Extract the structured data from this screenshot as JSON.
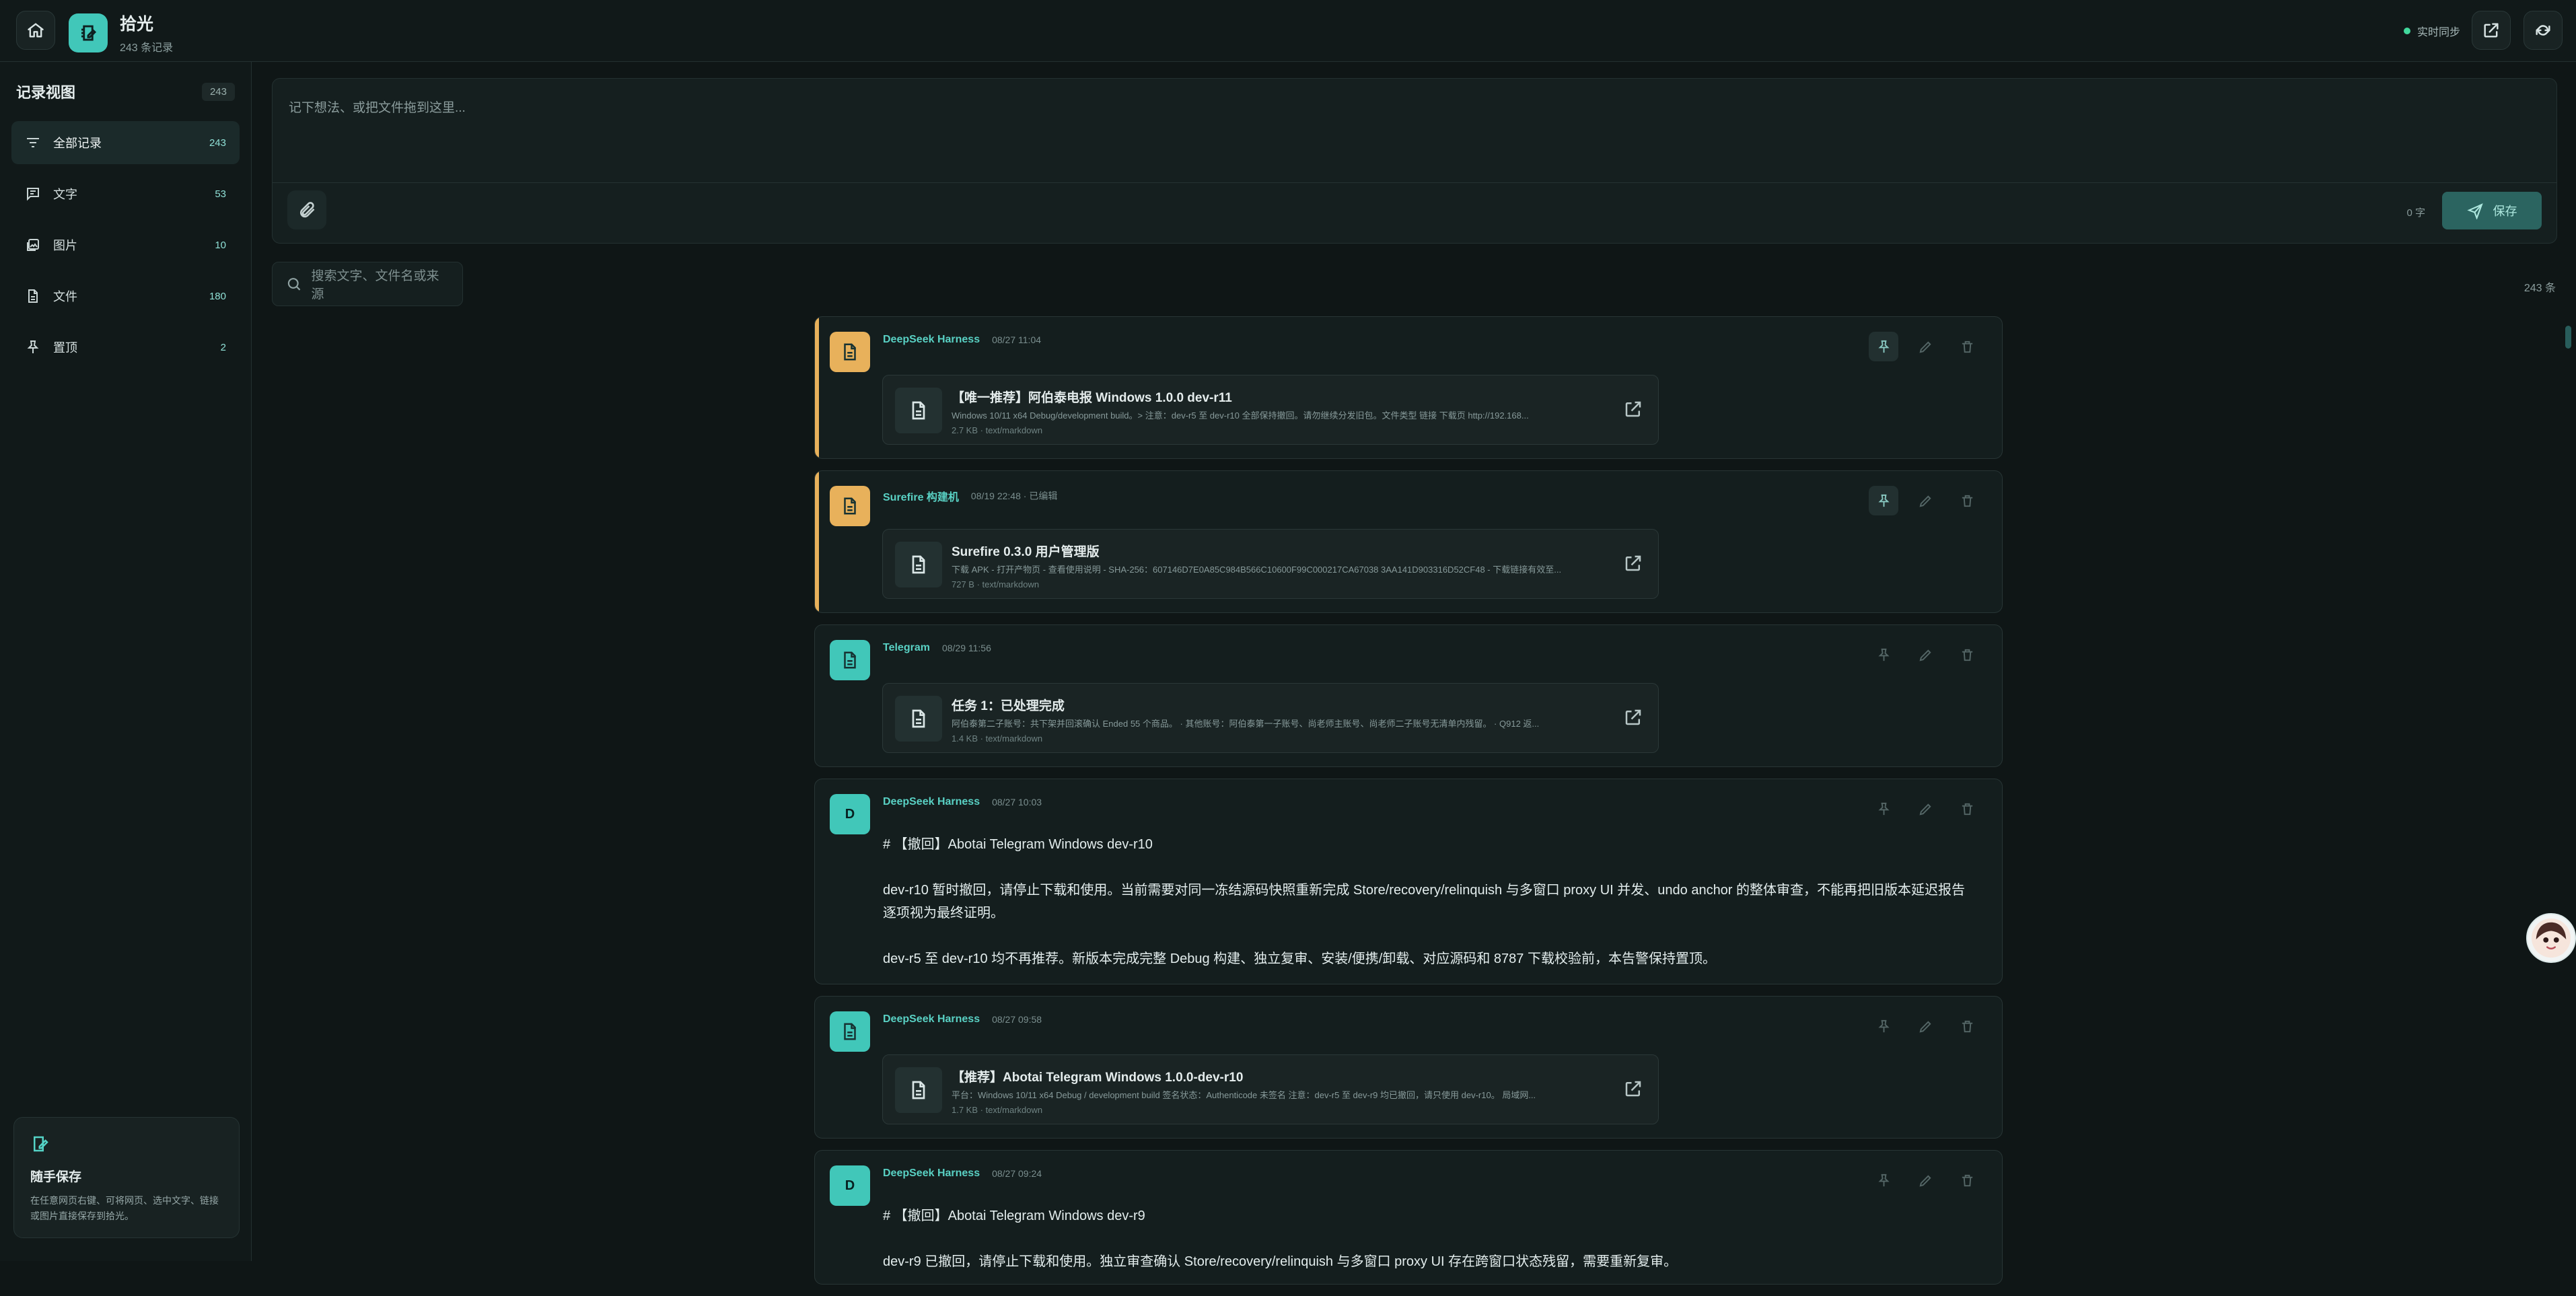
{
  "app": {
    "title": "拾光",
    "subtitle": "243 条记录",
    "sync": "实时同步",
    "colors": {
      "accent": "#41c7b9",
      "pinned": "#e8b15b",
      "background": "#0f1616"
    }
  },
  "sidebar": {
    "title": "记录视图",
    "total": "243",
    "items": [
      {
        "label": "全部记录",
        "count": "243",
        "icon": "list-filter-icon"
      },
      {
        "label": "文字",
        "count": "53",
        "icon": "message-text-icon"
      },
      {
        "label": "图片",
        "count": "10",
        "icon": "images-icon"
      },
      {
        "label": "文件",
        "count": "180",
        "icon": "file-icon"
      },
      {
        "label": "置顶",
        "count": "2",
        "icon": "pin-icon"
      }
    ],
    "tip": {
      "title": "随手保存",
      "text": "在任意网页右键、可将网页、选中文字、链接或图片直接保存到拾光。"
    }
  },
  "composer": {
    "placeholder": "记下想法、或把文件拖到这里...",
    "char_count": "0 字",
    "save_label": "保存"
  },
  "search": {
    "placeholder": "搜索文字、文件名或来源",
    "total": "243 条"
  },
  "records": [
    {
      "source": "DeepSeek Harness",
      "time": "08/27 11:04",
      "type": "file",
      "pinned": true,
      "file": {
        "title": "【唯一推荐】阿伯泰电报 Windows 1.0.0 dev-r11",
        "desc": "Windows 10/11 x64 Debug/development build。> 注意：dev-r5 至 dev-r10 全部保持撤回。请勿继续分发旧包。文件类型 链接 下载页 http://192.168...",
        "meta": "2.7 KB · text/markdown"
      }
    },
    {
      "source": "Surefire 构建机",
      "time": "08/19 22:48 · 已编辑",
      "type": "file",
      "pinned": true,
      "file": {
        "title": "Surefire 0.3.0 用户管理版",
        "desc": "下载 APK - 打开产物页 - 查看使用说明 - SHA-256：607146D7E0A85C984B566C10600F99C000217CA67038 3AA141D903316D52CF48 - 下载链接有效至...",
        "meta": "727 B · text/markdown"
      }
    },
    {
      "source": "Telegram",
      "time": "08/29 11:56",
      "type": "file",
      "pinned": false,
      "file": {
        "title": "任务 1：已处理完成",
        "desc": "阿伯泰第二子账号：共下架并回滚确认 Ended 55 个商品。 · 其他账号：阿伯泰第一子账号、尚老师主账号、尚老师二子账号无清单内残留。 · Q912 返...",
        "meta": "1.4 KB · text/markdown"
      }
    },
    {
      "source": "DeepSeek Harness",
      "time": "08/27 10:03",
      "type": "text",
      "avatar": "D",
      "lines": [
        "# 【撤回】Abotai Telegram Windows dev-r10",
        "dev-r10 暂时撤回，请停止下载和使用。当前需要对同一冻结源码快照重新完成 Store/recovery/relinquish 与多窗口 proxy UI 并发、undo anchor 的整体审查，不能再把旧版本延迟报告逐项视为最终证明。",
        "dev-r5 至 dev-r10 均不再推荐。新版本完成完整 Debug 构建、独立复审、安装/便携/卸载、对应源码和 8787 下载校验前，本告警保持置顶。"
      ]
    },
    {
      "source": "DeepSeek Harness",
      "time": "08/27 09:58",
      "type": "file",
      "pinned": false,
      "file": {
        "title": "【推荐】Abotai Telegram Windows 1.0.0-dev-r10",
        "desc": "平台：Windows 10/11 x64 Debug / development build 签名状态：Authenticode 未签名 注意：dev-r5 至 dev-r9 均已撤回，请只使用 dev-r10。 局域网...",
        "meta": "1.7 KB · text/markdown"
      }
    },
    {
      "source": "DeepSeek Harness",
      "time": "08/27 09:24",
      "type": "text",
      "avatar": "D",
      "lines": [
        "# 【撤回】Abotai Telegram Windows dev-r9",
        "dev-r9 已撤回，请停止下载和使用。独立审查确认 Store/recovery/relinquish 与多窗口 proxy UI 存在跨窗口状态残留，需要重新复审。"
      ]
    }
  ]
}
